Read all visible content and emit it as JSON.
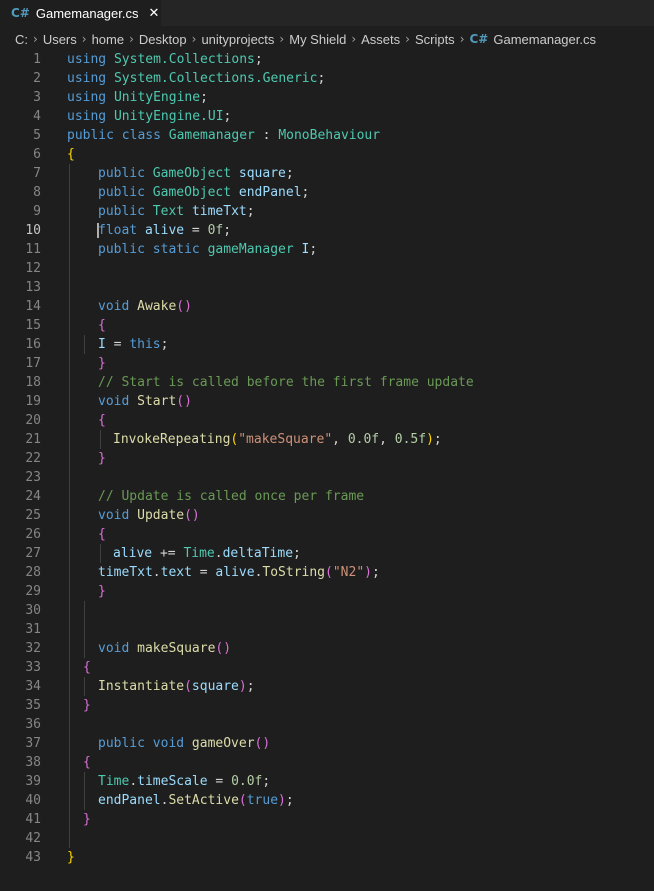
{
  "tab": {
    "icon": "C#",
    "title": "Gamemanager.cs",
    "close": "✕"
  },
  "breadcrumb": [
    {
      "label": "C:"
    },
    {
      "label": "Users"
    },
    {
      "label": "home"
    },
    {
      "label": "Desktop"
    },
    {
      "label": "unityprojects"
    },
    {
      "label": "My Shield"
    },
    {
      "label": "Assets"
    },
    {
      "label": "Scripts"
    },
    {
      "label": "Gamemanager.cs",
      "icon": "C#"
    }
  ],
  "active_line": 10,
  "code_lines": [
    [
      [
        "kw",
        "using"
      ],
      [
        "t",
        " "
      ],
      [
        "ty",
        "System.Collections"
      ],
      [
        "t",
        ";"
      ]
    ],
    [
      [
        "kw",
        "using"
      ],
      [
        "t",
        " "
      ],
      [
        "ty",
        "System.Collections.Generic"
      ],
      [
        "t",
        ";"
      ]
    ],
    [
      [
        "kw",
        "using"
      ],
      [
        "t",
        " "
      ],
      [
        "ty",
        "UnityEngine"
      ],
      [
        "t",
        ";"
      ]
    ],
    [
      [
        "kw",
        "using"
      ],
      [
        "t",
        " "
      ],
      [
        "ty",
        "UnityEngine.UI"
      ],
      [
        "t",
        ";"
      ]
    ],
    [
      [
        "kw",
        "public class"
      ],
      [
        "t",
        " "
      ],
      [
        "ty",
        "Gamemanager"
      ],
      [
        "t",
        " : "
      ],
      [
        "ty",
        "MonoBehaviour"
      ]
    ],
    [
      [
        "br1",
        "{"
      ]
    ],
    [
      [
        "kw",
        "public"
      ],
      [
        "t",
        " "
      ],
      [
        "ty",
        "GameObject"
      ],
      [
        "t",
        " "
      ],
      [
        "va",
        "square"
      ],
      [
        "t",
        ";"
      ]
    ],
    [
      [
        "kw",
        "public"
      ],
      [
        "t",
        " "
      ],
      [
        "ty",
        "GameObject"
      ],
      [
        "t",
        " "
      ],
      [
        "va",
        "endPanel"
      ],
      [
        "t",
        ";"
      ]
    ],
    [
      [
        "kw",
        "public"
      ],
      [
        "t",
        " "
      ],
      [
        "ty",
        "Text"
      ],
      [
        "t",
        " "
      ],
      [
        "va",
        "timeTxt"
      ],
      [
        "t",
        ";"
      ]
    ],
    [
      [
        "kw",
        "float"
      ],
      [
        "t",
        " "
      ],
      [
        "va",
        "alive"
      ],
      [
        "t",
        " = "
      ],
      [
        "nu",
        "0f"
      ],
      [
        "t",
        ";"
      ]
    ],
    [
      [
        "kw",
        "public static"
      ],
      [
        "t",
        " "
      ],
      [
        "ty",
        "gameManager"
      ],
      [
        "t",
        " "
      ],
      [
        "va",
        "I"
      ],
      [
        "t",
        ";"
      ]
    ],
    [],
    [],
    [
      [
        "kw",
        "void"
      ],
      [
        "t",
        " "
      ],
      [
        "fn",
        "Awake"
      ],
      [
        "br2",
        "()"
      ]
    ],
    [
      [
        "br2",
        "{"
      ]
    ],
    [
      [
        "va",
        "I"
      ],
      [
        "t",
        " = "
      ],
      [
        "kw",
        "this"
      ],
      [
        "t",
        ";"
      ]
    ],
    [
      [
        "br2",
        "}"
      ]
    ],
    [
      [
        "cm",
        "// Start is called before the first frame update"
      ]
    ],
    [
      [
        "kw",
        "void"
      ],
      [
        "t",
        " "
      ],
      [
        "fn",
        "Start"
      ],
      [
        "br2",
        "()"
      ]
    ],
    [
      [
        "br2",
        "{"
      ]
    ],
    [
      [
        "fn",
        "InvokeRepeating"
      ],
      [
        "br1",
        "("
      ],
      [
        "st",
        "\"makeSquare\""
      ],
      [
        "t",
        ", "
      ],
      [
        "nu",
        "0.0f"
      ],
      [
        "t",
        ", "
      ],
      [
        "nu",
        "0.5f"
      ],
      [
        "br1",
        ")"
      ],
      [
        "t",
        ";"
      ]
    ],
    [
      [
        "br2",
        "}"
      ]
    ],
    [],
    [
      [
        "cm",
        "// Update is called once per frame"
      ]
    ],
    [
      [
        "kw",
        "void"
      ],
      [
        "t",
        " "
      ],
      [
        "fn",
        "Update"
      ],
      [
        "br2",
        "()"
      ]
    ],
    [
      [
        "br2",
        "{"
      ]
    ],
    [
      [
        "va",
        "alive"
      ],
      [
        "t",
        " += "
      ],
      [
        "ty",
        "Time"
      ],
      [
        "t",
        "."
      ],
      [
        "va",
        "deltaTime"
      ],
      [
        "t",
        ";"
      ]
    ],
    [
      [
        "va",
        "timeTxt"
      ],
      [
        "t",
        "."
      ],
      [
        "va",
        "text"
      ],
      [
        "t",
        " = "
      ],
      [
        "va",
        "alive"
      ],
      [
        "t",
        "."
      ],
      [
        "fn",
        "ToString"
      ],
      [
        "br2",
        "("
      ],
      [
        "st",
        "\"N2\""
      ],
      [
        "br2",
        ")"
      ],
      [
        "t",
        ";"
      ]
    ],
    [
      [
        "br2",
        "}"
      ]
    ],
    [],
    [],
    [
      [
        "kw",
        "void"
      ],
      [
        "t",
        " "
      ],
      [
        "fn",
        "makeSquare"
      ],
      [
        "br2",
        "()"
      ]
    ],
    [
      [
        "br2",
        "{"
      ]
    ],
    [
      [
        "fn",
        "Instantiate"
      ],
      [
        "br2",
        "("
      ],
      [
        "va",
        "square"
      ],
      [
        "br2",
        ")"
      ],
      [
        "t",
        ";"
      ]
    ],
    [
      [
        "br2",
        "}"
      ]
    ],
    [],
    [
      [
        "kw",
        "public void"
      ],
      [
        "t",
        " "
      ],
      [
        "fn",
        "gameOver"
      ],
      [
        "br2",
        "()"
      ]
    ],
    [
      [
        "br2",
        "{"
      ]
    ],
    [
      [
        "ty",
        "Time"
      ],
      [
        "t",
        "."
      ],
      [
        "va",
        "timeScale"
      ],
      [
        "t",
        " = "
      ],
      [
        "nu",
        "0.0f"
      ],
      [
        "t",
        ";"
      ]
    ],
    [
      [
        "va",
        "endPanel"
      ],
      [
        "t",
        "."
      ],
      [
        "fn",
        "SetActive"
      ],
      [
        "br2",
        "("
      ],
      [
        "kw",
        "true"
      ],
      [
        "br2",
        ")"
      ],
      [
        "t",
        ";"
      ]
    ],
    [
      [
        "br2",
        "}"
      ]
    ],
    [],
    [
      [
        "br1",
        "}"
      ]
    ]
  ]
}
